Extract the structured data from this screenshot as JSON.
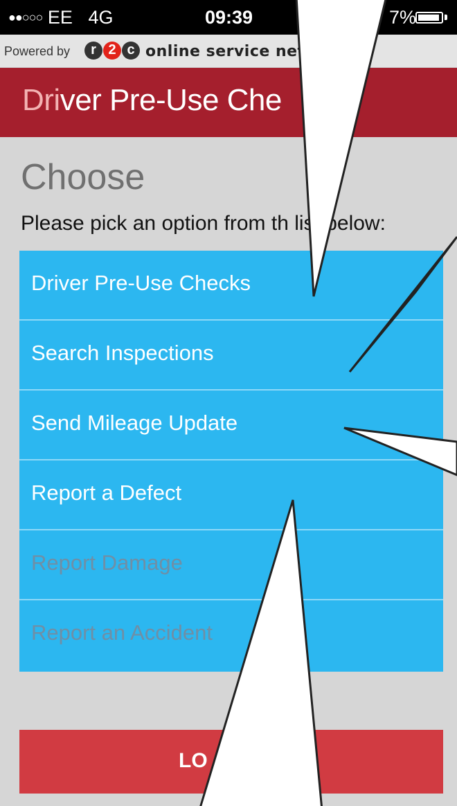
{
  "status_bar": {
    "signal": "●●○○○",
    "carrier": "EE",
    "network": "4G",
    "time": "09:39",
    "battery": "7%"
  },
  "powered_by": {
    "label": "Powered by",
    "logo_letters": [
      "r",
      "2",
      "c"
    ],
    "brand": "online service net"
  },
  "app_header": {
    "title_accent": "Dri",
    "title_rest": "ver Pre-Use Che"
  },
  "page": {
    "heading": "Choose",
    "subheading": "Please pick an option from th      list below:"
  },
  "menu": {
    "items": [
      {
        "label": "Driver Pre-Use Checks",
        "enabled": true
      },
      {
        "label": "Search Inspections",
        "enabled": true
      },
      {
        "label": "Send Mileage Update",
        "enabled": true
      },
      {
        "label": "Report a Defect",
        "enabled": true
      },
      {
        "label": "Report Damage",
        "enabled": false
      },
      {
        "label": "Report an Accident",
        "enabled": false
      }
    ]
  },
  "logout": {
    "label": "LO"
  },
  "colors": {
    "header": "#a51f2d",
    "menu_item": "#2cb7f0",
    "logout": "#d13b42",
    "background": "#d6d6d6"
  }
}
